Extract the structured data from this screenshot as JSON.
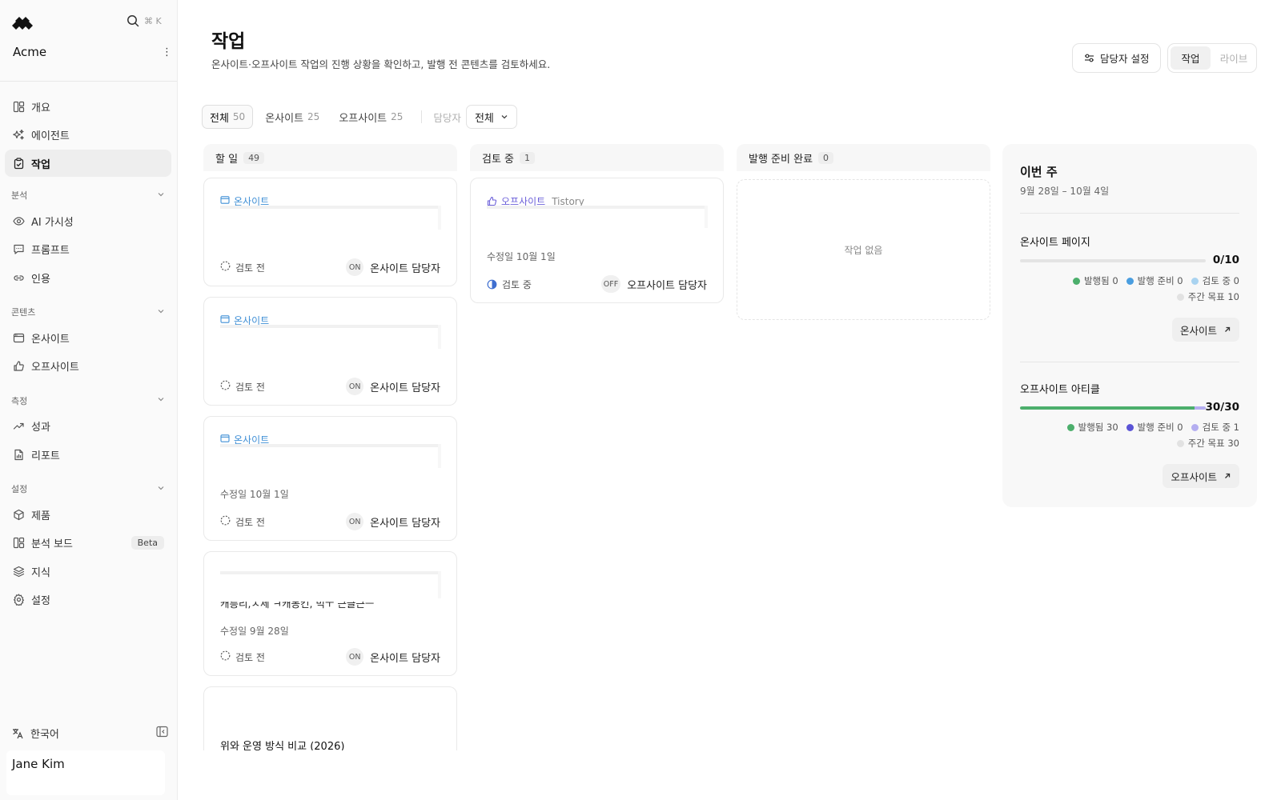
{
  "app": {
    "org_name": "Acme",
    "search_shortcut": "⌘ K"
  },
  "sidebar": {
    "top_items": [
      {
        "label": "개요",
        "icon": "dashboard-icon"
      },
      {
        "label": "에이전트",
        "icon": "sparkle-icon"
      },
      {
        "label": "작업",
        "icon": "clipboard-icon",
        "active": true
      }
    ],
    "sections": [
      {
        "title": "분석",
        "items": [
          {
            "label": "AI 가시성",
            "icon": "eye-icon"
          },
          {
            "label": "프롬프트",
            "icon": "chat-icon"
          },
          {
            "label": "인용",
            "icon": "link-icon"
          }
        ]
      },
      {
        "title": "콘텐츠",
        "items": [
          {
            "label": "온사이트",
            "icon": "browser-icon"
          },
          {
            "label": "오프사이트",
            "icon": "thumbs-up-icon"
          }
        ]
      },
      {
        "title": "측정",
        "items": [
          {
            "label": "성과",
            "icon": "trend-icon"
          },
          {
            "label": "리포트",
            "icon": "report-icon"
          }
        ]
      },
      {
        "title": "설정",
        "items": [
          {
            "label": "제품",
            "icon": "box-icon"
          },
          {
            "label": "분석 보드",
            "icon": "dashboard-icon",
            "badge": "Beta"
          },
          {
            "label": "지식",
            "icon": "layers-icon"
          },
          {
            "label": "설정",
            "icon": "gear-icon"
          }
        ]
      }
    ],
    "language": "한국어",
    "user_name": "Jane Kim"
  },
  "header": {
    "title": "작업",
    "subtitle": "온사이트·오프사이트 작업의 진행 상황을 확인하고, 발행 전 콘텐츠를 검토하세요.",
    "assignee_button": "담당자 설정",
    "view_toggle": [
      "작업",
      "라이브"
    ]
  },
  "filters": {
    "tabs": [
      {
        "label": "전체",
        "count": "50"
      },
      {
        "label": "온사이트",
        "count": "25"
      },
      {
        "label": "오프사이트",
        "count": "25"
      }
    ],
    "assignee_label": "담당자",
    "assignee_value": "전체"
  },
  "board": {
    "columns": [
      {
        "title": "할 일",
        "count": "49"
      },
      {
        "title": "검토 중",
        "count": "1"
      },
      {
        "title": "발행 준비 완료",
        "count": "0",
        "empty_text": "작업 없음"
      }
    ],
    "todo_cards": [
      {
        "tag": "온사이트",
        "status": "검토 전",
        "chip": "ON",
        "owner": "온사이트 담당자"
      },
      {
        "tag": "온사이트",
        "status": "검토 전",
        "chip": "ON",
        "owner": "온사이트 담당자"
      },
      {
        "tag": "온사이트",
        "date": "수정일 10월 1일",
        "status": "검토 전",
        "chip": "ON",
        "owner": "온사이트 담당자"
      },
      {
        "clipped_text": "캐릉리,ㅅ세 ㅋ캐몽킨, 믹ㅜ 근글근ㅡ",
        "date": "수정일 9월 28일",
        "status": "검토 전",
        "chip": "ON",
        "owner": "온사이트 담당자"
      },
      {
        "title": "위와 운영 방식 비교 (2026)"
      }
    ],
    "review_card": {
      "tag": "오프사이트",
      "source": "Tistory",
      "date": "수정일 10월 1일",
      "status": "검토 중",
      "chip": "OFF",
      "owner": "오프사이트 담당자"
    }
  },
  "week": {
    "title": "이번 주",
    "range": "9월 28일 – 10월 4일",
    "onsite": {
      "title": "온사이트 페이지",
      "value": "0/10",
      "progress": 0,
      "legend": [
        "발행됨 0",
        "발행 준비 0",
        "검토 중 0"
      ],
      "target": "주간 목표 10",
      "link": "온사이트"
    },
    "offsite": {
      "title": "오프사이트 아티클",
      "value": "30/30",
      "progress": 1.0,
      "legend": [
        "발행됨 30",
        "발행 준비 0",
        "검토 중 1"
      ],
      "target": "주간 목표 30",
      "link": "오프사이트"
    },
    "colors": {
      "published": "#4caf6c",
      "ready_onsite": "#4a9ee0",
      "review_onsite": "#a9d3f0",
      "ready_offsite": "#5b54d6",
      "review_offsite": "#b4aef0",
      "target": "#e2e2e2"
    }
  }
}
